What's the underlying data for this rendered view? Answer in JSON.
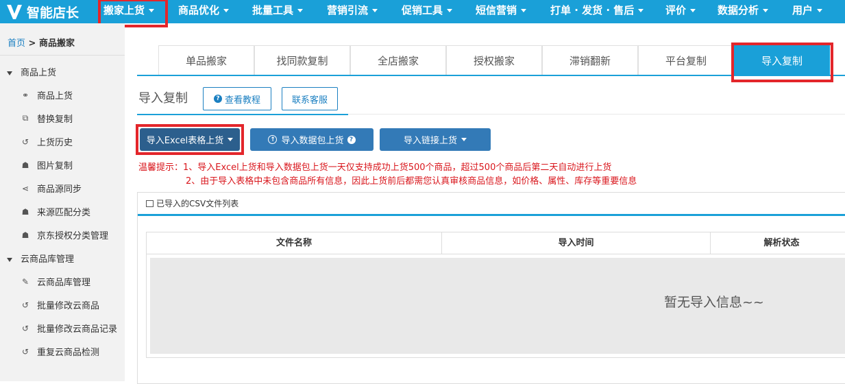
{
  "app": {
    "logo_text": "智能店长"
  },
  "topnav": [
    {
      "label": "搬家上货"
    },
    {
      "label": "商品优化"
    },
    {
      "label": "批量工具"
    },
    {
      "label": "营销引流"
    },
    {
      "label": "促销工具"
    },
    {
      "label": "短信营销"
    },
    {
      "label": "打单 · 发货 · 售后"
    },
    {
      "label": "评价"
    },
    {
      "label": "数据分析"
    },
    {
      "label": "用户"
    }
  ],
  "breadcrumb": {
    "home": "首页",
    "sep": ">",
    "current": "商品搬家"
  },
  "sidebar": {
    "group1": "商品上货",
    "group1_items": [
      "商品上货",
      "替换复制",
      "上货历史",
      "图片复制",
      "商品源同步",
      "来源匹配分类",
      "京东授权分类管理"
    ],
    "group2": "云商品库管理",
    "group2_items": [
      "云商品库管理",
      "批量修改云商品",
      "批量修改云商品记录",
      "重复云商品检测"
    ]
  },
  "tabs": [
    "单品搬家",
    "找同款复制",
    "全店搬家",
    "授权搬家",
    "滞销翻新",
    "平台复制",
    "导入复制"
  ],
  "active_tab": "导入复制",
  "page": {
    "title": "导入复制",
    "tutorial_button": "查看教程",
    "contact_button": "联系客服"
  },
  "actions": {
    "excel": "导入Excel表格上货",
    "package": "导入数据包上货",
    "link": "导入链接上货"
  },
  "tips": {
    "prefix": "温馨提示：",
    "line1": "1、导入Excel上货和导入数据包上货一天仅支持成功上货500个商品，超过500个商品后第二天自动进行上货",
    "line2": "2、由于导入表格中未包含商品所有信息，因此上货前后都需您认真审核商品信息，如价格、属性、库存等重要信息"
  },
  "panel": {
    "title": "已导入的CSV文件列表",
    "columns": [
      "文件名称",
      "导入时间",
      "解析状态"
    ],
    "empty_text": "暂无导入信息~~"
  },
  "colors": {
    "brand": "#1aa0d8",
    "button": "#337ab7",
    "highlight": "#e3262b",
    "tip": "#d9161c"
  }
}
